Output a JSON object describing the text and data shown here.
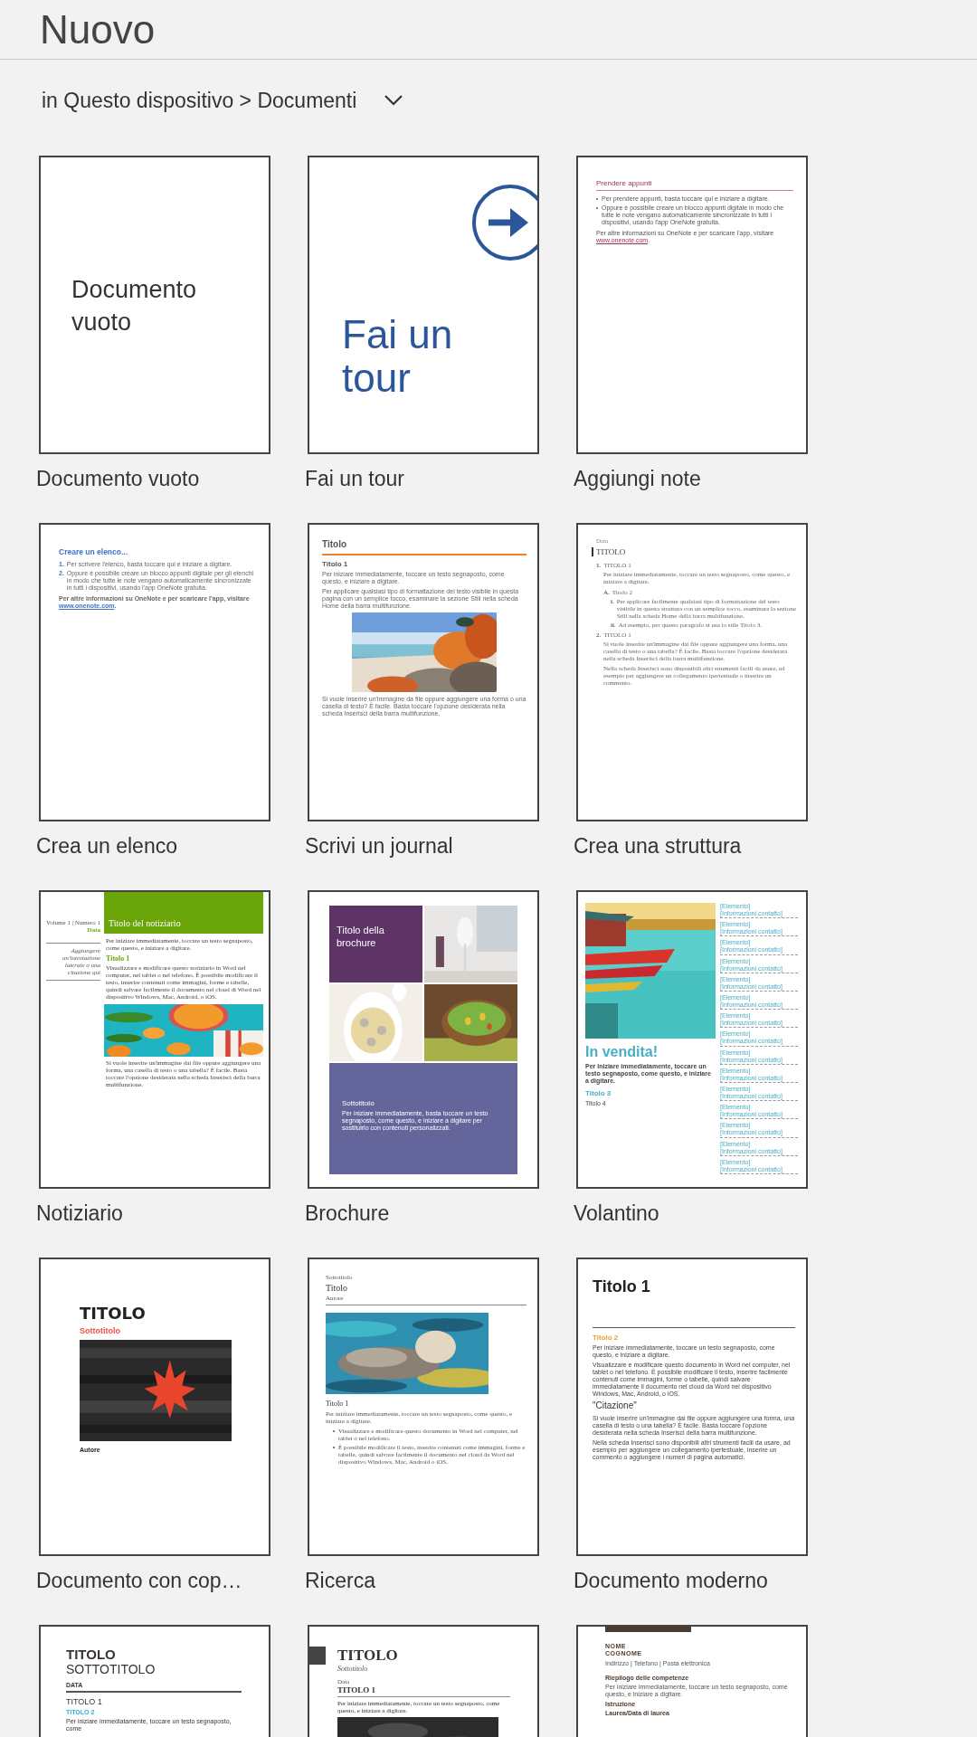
{
  "header": {
    "title": "Nuovo"
  },
  "location": {
    "text": "in Questo dispositivo > Documenti"
  },
  "templates": [
    {
      "label": "Documento vuoto",
      "kind": "blank",
      "caption": "Documento vuoto"
    },
    {
      "label": "Fai un tour",
      "kind": "tour",
      "caption": "Fai un tour"
    },
    {
      "label": "Aggiungi note",
      "kind": "notes",
      "blocks": [
        {
          "kind": "heading",
          "text": "Prendere appunti"
        },
        {
          "kind": "bullet",
          "text": "Per prendere appunti, basta toccare qui e iniziare a digitare."
        },
        {
          "kind": "bullet",
          "text": "Oppure è possibile creare un blocco appunti digitale in modo che tutte le note vengano automaticamente sincronizzate in tutti i dispositivi, usando l'app OneNote gratuita."
        },
        {
          "kind": "link-para",
          "text": "Per altre informazioni su OneNote e per scaricare l'app, visitare",
          "link": "www.onenote.com",
          "after": "."
        }
      ]
    },
    {
      "label": "Crea un elenco",
      "kind": "list",
      "blocks": [
        {
          "kind": "heading",
          "text": "Creare un elenco..."
        },
        {
          "kind": "numbered",
          "number": "1.",
          "text": "Per scrivere l'elenco, basta toccare qui e iniziare a digitare."
        },
        {
          "kind": "numbered",
          "number": "2.",
          "text": "Oppure è possibile creare un blocco appunti digitale per gli elenchi in modo che tutte le note vengano automaticamente sincronizzate in tutti i dispositivi, usando l'app OneNote gratuita."
        },
        {
          "kind": "link-para",
          "text": "Per altre informazioni su OneNote e per scaricare l'app, visitare",
          "link": "www.onenote.com",
          "after": "."
        }
      ]
    },
    {
      "label": "Scrivi un journal",
      "kind": "journal",
      "blocks": [
        {
          "kind": "title",
          "text": "Titolo"
        },
        {
          "kind": "rule"
        },
        {
          "kind": "heading",
          "text": "Titolo 1"
        },
        {
          "kind": "text",
          "text": "Per iniziare immediatamente, toccare un testo segnaposto, come questo, e iniziare a digitare."
        },
        {
          "kind": "text",
          "text": "Per applicare qualsiasi tipo di formattazione del testo visibile in questa pagina con un semplice tocco, esaminare la sezione Stili nella scheda Home della barra multifunzione."
        },
        {
          "kind": "picture"
        },
        {
          "kind": "text",
          "text": "Si vuole inserire un'immagine da file oppure aggiungere una forma o una casella di testo? È facile. Basta toccare l'opzione desiderata nella scheda Inserisci della barra multifunzione."
        }
      ]
    },
    {
      "label": "Crea una struttura",
      "kind": "outline",
      "blocks": [
        {
          "kind": "meta",
          "text": "Data"
        },
        {
          "kind": "title",
          "text": "TITOLO"
        },
        {
          "kind": "numbered",
          "number": "1.",
          "text": "TITOLO 1",
          "children": [
            {
              "kind": "text",
              "text": "Per iniziare immediatamente, toccare un testo segnaposto, come questo, e iniziare a digitare."
            },
            {
              "kind": "numbered",
              "number": "A.",
              "text": "Titolo 2",
              "children": [
                {
                  "kind": "numbered",
                  "number": "i.",
                  "text": "Per applicare facilmente qualsiasi tipo di formattazione del testo visibile in questa struttura con un semplice tocco, esaminare la sezione Stili nella scheda Home della barra multifunzione."
                },
                {
                  "kind": "numbered",
                  "number": "ii.",
                  "text": "Ad esempio, per questo paragrafo si usa lo stile Titolo 3."
                }
              ]
            }
          ]
        },
        {
          "kind": "numbered",
          "number": "2.",
          "text": "TITOLO 1",
          "children": [
            {
              "kind": "text",
              "text": "Si vuole inserire un'immagine dai file oppure aggiungere una forma, una casella di testo o una tabella? È facile. Basta toccare l'opzione desiderata nella scheda Inserisci della barra multifunzione."
            },
            {
              "kind": "text",
              "text": "Nella scheda Inserisci sono disponibili altri strumenti facili da usare, ad esempio per aggiungere un collegamento ipertestuale o inserire un commento."
            }
          ]
        }
      ]
    },
    {
      "label": "Notiziario",
      "kind": "newsletter",
      "volume": "Volume 1 | Numero 1",
      "date": "Data",
      "title": "Titolo del notiziario",
      "aside": "Aggiungere un'intestazione laterale o una citazione qui",
      "blocks": [
        {
          "kind": "text",
          "text": "Per iniziare immediatamente, toccare un testo segnaposto, come questo, e iniziare a digitare."
        },
        {
          "kind": "heading",
          "text": "Titolo 1"
        },
        {
          "kind": "text",
          "text": "Visualizzare e modificare questo notiziario in Word nel computer, nel tablet o nel telefono. È possibile modificare il testo, inserire contenuti come immagini, forme e tabelle, quindi salvare facilmente il documento nel cloud di Word nel dispositivo Windows, Mac, Android, o iOS."
        },
        {
          "kind": "picture"
        },
        {
          "kind": "text",
          "text": "Si vuole inserire un'immagine dai file oppure aggiungere una forma, una casella di testo o una tabella? È facile. Basta toccare l'opzione desiderata nella scheda Inserisci della barra multifunzione."
        }
      ]
    },
    {
      "label": "Brochure",
      "kind": "brochure",
      "title": "Titolo della brochure",
      "subtitle": "Sottotitolo",
      "text": "Per iniziare immediatamente, basta toccare un testo segnaposto, come questo, e iniziare a digitare per sostituirlo con contenuti personalizzati."
    },
    {
      "label": "Volantino",
      "kind": "flyer",
      "title": "In vendita!",
      "text": "Per iniziare immediatamente, toccare un testo segnaposto, come questo, e iniziare a digitare.",
      "heading": "Titolo 3",
      "subheading": "Titolo 4",
      "sidebar": [
        {
          "item": "[Elemento]",
          "contact": "[Informazioni contatto]"
        },
        {
          "item": "[Elemento]",
          "contact": "[Informazioni contatto]"
        },
        {
          "item": "[Elemento]",
          "contact": "[Informazioni contatto]"
        },
        {
          "item": "[Elemento]",
          "contact": "[Informazioni contatto]"
        },
        {
          "item": "[Elemento]",
          "contact": "[Informazioni contatto]"
        },
        {
          "item": "[Elemento]",
          "contact": "[Informazioni contatto]"
        },
        {
          "item": "[Elemento]",
          "contact": "[Informazioni contatto]"
        },
        {
          "item": "[Elemento]",
          "contact": "[Informazioni contatto]"
        },
        {
          "item": "[Elemento]",
          "contact": "[Informazioni contatto]"
        },
        {
          "item": "[Elemento]",
          "contact": "[Informazioni contatto]"
        },
        {
          "item": "[Elemento]",
          "contact": "[Informazioni contatto]"
        },
        {
          "item": "[Elemento]",
          "contact": "[Informazioni contatto]"
        },
        {
          "item": "[Elemento]",
          "contact": "[Informazioni contatto]"
        },
        {
          "item": "[Elemento]",
          "contact": "[Informazioni contatto]"
        },
        {
          "item": "[Elemento]",
          "contact": "[Informazioni contatto]"
        }
      ]
    },
    {
      "label": "Documento con cop…",
      "kind": "cover",
      "blocks": [
        {
          "kind": "title",
          "text": "TITOLO"
        },
        {
          "kind": "subtitle",
          "text": "Sottotitolo"
        },
        {
          "kind": "picture"
        },
        {
          "kind": "meta",
          "text": "Autore"
        }
      ]
    },
    {
      "label": "Ricerca",
      "kind": "research",
      "blocks": [
        {
          "kind": "meta",
          "text": "Sottotitolo"
        },
        {
          "kind": "title",
          "text": "Titolo"
        },
        {
          "kind": "meta",
          "text": "Autore"
        },
        {
          "kind": "rule"
        },
        {
          "kind": "picture"
        },
        {
          "kind": "heading",
          "text": "Titolo 1"
        },
        {
          "kind": "text",
          "text": "Per iniziare immediatamente, toccare un testo segnaposto, come questo, e iniziare a digitare."
        },
        {
          "kind": "bullet",
          "text": "Visualizzare e modificare questo documento in Word nel computer, nel tablet o nel telefono."
        },
        {
          "kind": "bullet",
          "text": "È possibile modificare il testo, inserire contenuti come immagini, forme e tabelle, quindi salvare facilmente il documento nel cloud da Word nel dispositivo Windows, Mac, Android o iOS."
        }
      ]
    },
    {
      "label": "Documento moderno",
      "kind": "modern",
      "blocks": [
        {
          "kind": "title",
          "text": "Titolo 1"
        },
        {
          "kind": "rule"
        },
        {
          "kind": "heading",
          "text": "Titolo 2"
        },
        {
          "kind": "lead",
          "text": "Per iniziare immediatamente, toccare un testo segnaposto, come questo, e iniziare a digitare."
        },
        {
          "kind": "text",
          "text": "Visualizzare e modificare questo documento in Word nel computer, nel tablet o nel telefono. È possibile modificare il testo, inserire facilmente contenuti come immagini, forme o tabelle, quindi salvare immediatamente il documento nel cloud da Word nel dispositivo Windows, Mac, Android, o iOS."
        },
        {
          "kind": "quote",
          "text": "\"Citazione\""
        },
        {
          "kind": "text",
          "text": "Si vuole inserire un'immagine dai file oppure aggiungere una forma, una casella di testo o una tabella? È facile. Basta toccare l'opzione desiderata nella scheda Inserisci della barra multifunzione."
        },
        {
          "kind": "text",
          "text": "Nella scheda Inserisci sono disponibili altri strumenti facili da usare, ad esempio per aggiungere un collegamento ipertestuale, inserire un commento o aggiungere i numeri di pagina automatici."
        }
      ]
    },
    {
      "kind": "report",
      "blocks": [
        {
          "kind": "title",
          "text": "TITOLO"
        },
        {
          "kind": "subtitle",
          "text": "SOTTOTITOLO"
        },
        {
          "kind": "meta",
          "text": "DATA"
        },
        {
          "kind": "rule"
        },
        {
          "kind": "heading",
          "text": "TITOLO 1"
        },
        {
          "kind": "subheading",
          "text": "TITOLO 2"
        },
        {
          "kind": "text",
          "text": "Per iniziare immediatamente, toccare un testo segnaposto, come"
        }
      ]
    },
    {
      "kind": "journal2",
      "blocks": [
        {
          "kind": "title",
          "text": "TITOLO"
        },
        {
          "kind": "subtitle",
          "text": "Sottotitolo"
        },
        {
          "kind": "meta",
          "text": "Data"
        },
        {
          "kind": "heading",
          "text": "TITOLO 1"
        },
        {
          "kind": "rule"
        },
        {
          "kind": "text",
          "text": "Per iniziare immediatamente, toccare un testo segnaposto, come questo, e iniziare a digitare."
        },
        {
          "kind": "picture"
        }
      ]
    },
    {
      "kind": "resume",
      "blocks": [
        {
          "kind": "bar"
        },
        {
          "kind": "title",
          "text": "NOME"
        },
        {
          "kind": "title",
          "text": "COGNOME"
        },
        {
          "kind": "meta",
          "text": "Indirizzo | Telefono | Posta elettronica"
        },
        {
          "kind": "heading",
          "text": "Riepilogo delle competenze"
        },
        {
          "kind": "text",
          "text": "Per iniziare immediatamente, toccare un testo segnaposto, come questo, e iniziare a digitare."
        },
        {
          "kind": "heading",
          "text": "Istruzione"
        },
        {
          "kind": "subheading",
          "text": "Laurea/Data di laurea"
        }
      ]
    }
  ]
}
